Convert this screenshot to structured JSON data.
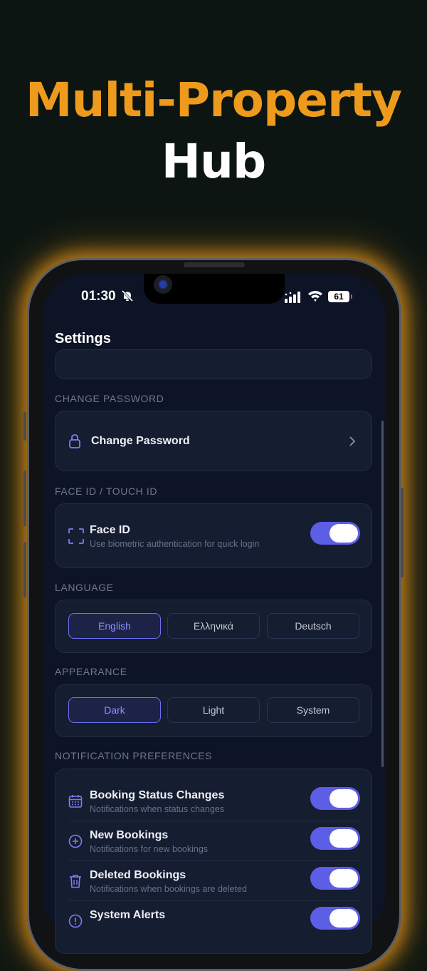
{
  "hero": {
    "line1": "Multi-Property",
    "line2": "Hub"
  },
  "status_bar": {
    "time": "01:30",
    "battery": "61"
  },
  "settings": {
    "title": "Settings",
    "change_password": {
      "section": "CHANGE PASSWORD",
      "label": "Change Password"
    },
    "face_id": {
      "section": "FACE ID / TOUCH ID",
      "title": "Face ID",
      "subtitle": "Use biometric authentication for quick login",
      "enabled": true
    },
    "language": {
      "section": "LANGUAGE",
      "options": [
        "English",
        "Ελληνικά",
        "Deutsch"
      ],
      "selected": "English"
    },
    "appearance": {
      "section": "APPEARANCE",
      "options": [
        "Dark",
        "Light",
        "System"
      ],
      "selected": "Dark"
    },
    "notifications": {
      "section": "NOTIFICATION PREFERENCES",
      "items": [
        {
          "title": "Booking Status Changes",
          "subtitle": "Notifications when status changes",
          "icon": "calendar-icon",
          "enabled": true
        },
        {
          "title": "New Bookings",
          "subtitle": "Notifications for new bookings",
          "icon": "plus-circle-icon",
          "enabled": true
        },
        {
          "title": "Deleted Bookings",
          "subtitle": "Notifications when bookings are deleted",
          "icon": "trash-icon",
          "enabled": true
        },
        {
          "title": "System Alerts",
          "subtitle": "",
          "icon": "alert-circle-icon",
          "enabled": true
        }
      ]
    }
  },
  "colors": {
    "accent": "#5d5ee6",
    "hero_orange": "#ee9a1c",
    "background": "#0d1426"
  }
}
